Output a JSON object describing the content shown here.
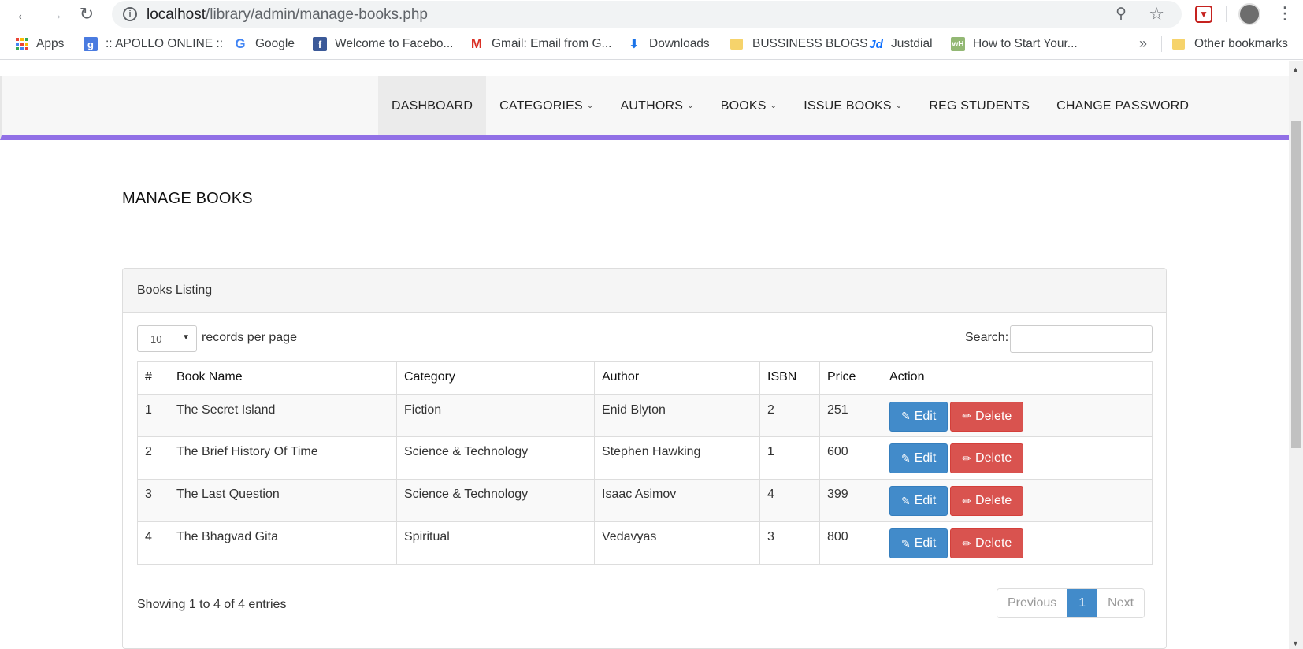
{
  "browser": {
    "url_host": "localhost",
    "url_path": "/library/admin/manage-books.php",
    "bookmarks": [
      {
        "label": "Apps",
        "icon": "apps-grid-icon"
      },
      {
        "label": ":: APOLLO ONLINE ::",
        "icon": "google-plus-icon"
      },
      {
        "label": "Google",
        "icon": "google-icon"
      },
      {
        "label": "Welcome to Facebo...",
        "icon": "facebook-icon"
      },
      {
        "label": "Gmail: Email from G...",
        "icon": "gmail-icon"
      },
      {
        "label": "Downloads",
        "icon": "download-icon"
      },
      {
        "label": "BUSSINESS BLOGS",
        "icon": "folder-icon"
      },
      {
        "label": "Justdial",
        "icon": "justdial-icon"
      },
      {
        "label": "How to Start Your...",
        "icon": "wikihow-icon"
      }
    ],
    "more_bookmarks": "»",
    "other_bookmarks": "Other bookmarks"
  },
  "nav": {
    "items": [
      {
        "label": "DASHBOARD",
        "dropdown": false,
        "active": true
      },
      {
        "label": "CATEGORIES",
        "dropdown": true
      },
      {
        "label": "AUTHORS",
        "dropdown": true
      },
      {
        "label": "BOOKS",
        "dropdown": true
      },
      {
        "label": "ISSUE BOOKS",
        "dropdown": true
      },
      {
        "label": "REG STUDENTS",
        "dropdown": false
      },
      {
        "label": "CHANGE PASSWORD",
        "dropdown": false
      }
    ],
    "accent_color": "#9170e6"
  },
  "page": {
    "title": "MANAGE BOOKS"
  },
  "panel": {
    "title": "Books Listing",
    "length_value": "10",
    "length_label": "records per page",
    "search_label": "Search:",
    "search_value": ""
  },
  "table": {
    "headers": [
      "#",
      "Book Name",
      "Category",
      "Author",
      "ISBN",
      "Price",
      "Action"
    ],
    "rows": [
      {
        "num": "1",
        "name": "The Secret Island",
        "category": "Fiction",
        "author": "Enid Blyton",
        "isbn": "2",
        "price": "251"
      },
      {
        "num": "2",
        "name": "The Brief History Of Time",
        "category": "Science & Technology",
        "author": "Stephen Hawking",
        "isbn": "1",
        "price": "600"
      },
      {
        "num": "3",
        "name": "The Last Question",
        "category": "Science & Technology",
        "author": "Isaac Asimov",
        "isbn": "4",
        "price": "399"
      },
      {
        "num": "4",
        "name": "The Bhagvad Gita",
        "category": "Spiritual",
        "author": "Vedavyas",
        "isbn": "3",
        "price": "800"
      }
    ],
    "edit_label": "Edit",
    "delete_label": "Delete",
    "edit_color": "#428bca",
    "delete_color": "#d9534f"
  },
  "footer": {
    "info": "Showing 1 to 4 of 4 entries",
    "prev_label": "Previous",
    "current_page": "1",
    "next_label": "Next"
  }
}
